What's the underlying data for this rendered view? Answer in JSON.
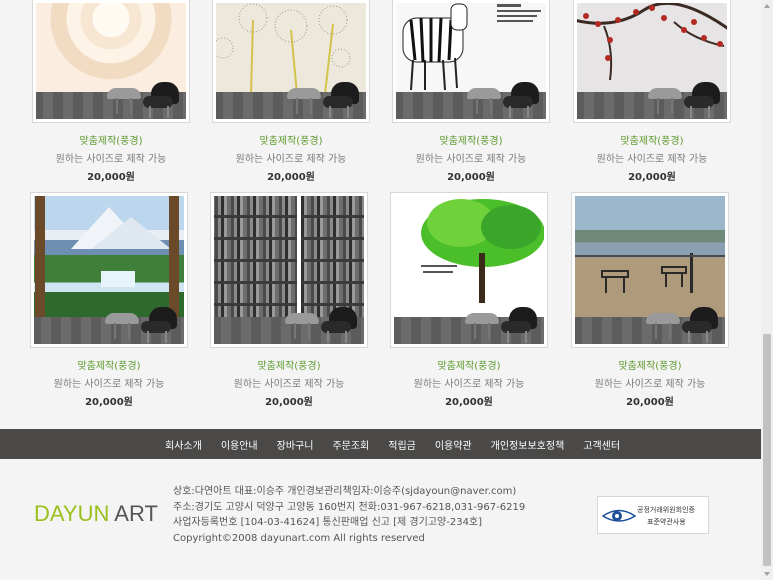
{
  "products": [
    {
      "name": "맞춤제작(풍경)",
      "desc": "원하는 사이즈로 제작 가능",
      "price": "20,000원",
      "image": "cream-rose-wallpaper"
    },
    {
      "name": "맞춤제작(풍경)",
      "desc": "원하는 사이즈로 제작 가능",
      "price": "20,000원",
      "image": "dandelion-wallpaper"
    },
    {
      "name": "맞춤제작(풍경)",
      "desc": "원하는 사이즈로 제작 가능",
      "price": "20,000원",
      "image": "zebra-wallpaper"
    },
    {
      "name": "맞춤제작(풍경)",
      "desc": "원하는 사이즈로 제작 가능",
      "price": "20,000원",
      "image": "plum-blossom-wallpaper"
    },
    {
      "name": "맞춤제작(풍경)",
      "desc": "원하는 사이즈로 제작 가능",
      "price": "20,000원",
      "image": "mountain-waterfall-wallpaper"
    },
    {
      "name": "맞춤제작(풍경)",
      "desc": "원하는 사이즈로 제작 가능",
      "price": "20,000원",
      "image": "bookshelf-wallpaper"
    },
    {
      "name": "맞춤제작(풍경)",
      "desc": "원하는 사이즈로 제작 가능",
      "price": "20,000원",
      "image": "green-tree-wallpaper"
    },
    {
      "name": "맞춤제작(풍경)",
      "desc": "원하는 사이즈로 제작 가능",
      "price": "20,000원",
      "image": "lake-terrace-wallpaper"
    }
  ],
  "footer_nav": [
    "회사소개",
    "이용안내",
    "장바구니",
    "주문조회",
    "적립금",
    "이용약관",
    "개인정보보호정책",
    "고객센터"
  ],
  "logo": {
    "part1": "DAYUN",
    "part2": "ART"
  },
  "company_info": {
    "line1": "상호:다연아트  대표:이승주  개인경보관리책임자:이승주(sjdayoun@naver.com)",
    "line2": "주소:경기도 고양시 덕양구 고양동 160번지 전화:031-967-6218,031-967-6219",
    "line3": "사업자등록번호 [104-03-41624] 통신판매업 신고 [제 경기고양-234호]",
    "line4": "Copyright©2008 dayunart.com All rights reserved"
  },
  "certification": {
    "line1": "공정거래위원회인증",
    "line2": "표준약관사용"
  },
  "colors": {
    "accent_green": "#9ac01c",
    "product_name": "#5d9b2f",
    "footer_nav_bg": "#4a4948",
    "page_bg": "#f5f4f4"
  }
}
